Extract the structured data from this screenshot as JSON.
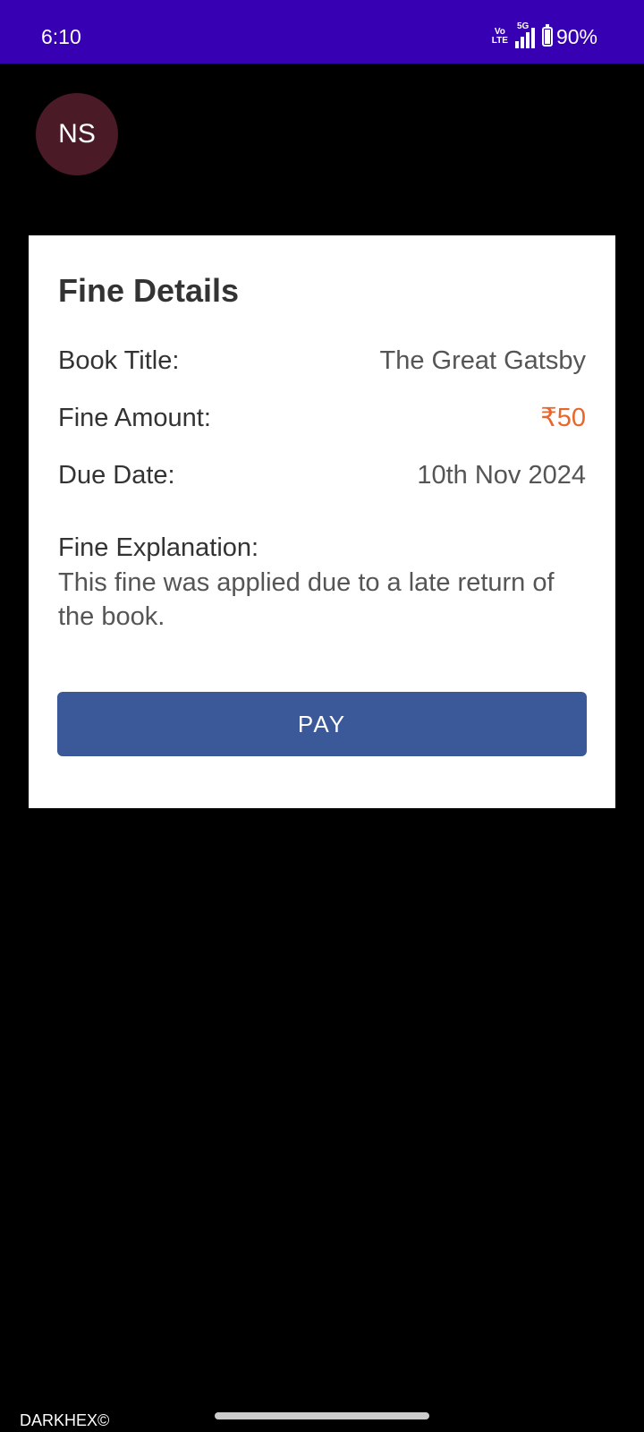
{
  "status_bar": {
    "time": "6:10",
    "volte_top": "Vo",
    "volte_bottom": "LTE",
    "network": "5G",
    "battery_percent": "90%",
    "battery_level": 0.9,
    "background_color": "#3700b3"
  },
  "avatar": {
    "initials": "NS",
    "color": "#4a1a26"
  },
  "card": {
    "title": "Fine Details",
    "rows": [
      {
        "label": "Book Title:",
        "value": "The Great Gatsby"
      },
      {
        "label": "Fine Amount:",
        "value": "₹50"
      },
      {
        "label": "Due Date:",
        "value": "10th Nov 2024"
      }
    ],
    "amount_color": "#e8652b",
    "explanation_label": "Fine Explanation:",
    "explanation_text": "This fine was applied due to a late return of the book.",
    "pay_label": "PAY",
    "pay_color": "#3b5998"
  },
  "watermark": "DARKHEX©"
}
